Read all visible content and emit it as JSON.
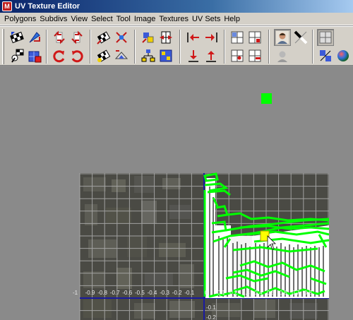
{
  "window": {
    "title": "UV Texture Editor",
    "app_icon": "maya-icon"
  },
  "menubar": {
    "items": [
      "Polygons",
      "Subdivs",
      "View",
      "Select",
      "Tool",
      "Image",
      "Textures",
      "UV Sets",
      "Help"
    ]
  },
  "toolbar": {
    "row1": [
      "checker-uv-icon",
      "flip-uv-icon",
      "rotate-left-arrows-icon",
      "rotate-right-arrows-icon",
      "checker-move-icon",
      "checker-scale-icon",
      "cut-uv-icon",
      "sew-uv-icon",
      "move-left-icon",
      "move-right-icon",
      "grid-snap-icon",
      "grid-add-icon",
      "user-portrait-icon",
      "black-white-icon",
      "display-grid-icon"
    ],
    "row2": [
      "paint-uv-icon",
      "select-shell-icon",
      "rotate-ccw-icon",
      "rotate-cw-icon",
      "checker-flip-icon",
      "checker-unfold-icon",
      "hierarchy-icon",
      "layout-uv-icon",
      "move-down-icon",
      "move-up-icon",
      "grid-point-icon",
      "grid-remove-icon",
      "user-portrait-gray-icon",
      "texture-swap-icon",
      "color-sphere-icon"
    ]
  },
  "viewport": {
    "axis_labels": [
      "-1",
      "-0.9",
      "-0.8",
      "-0.7",
      "-0.6",
      "-0.5",
      "-0.4",
      "-0.3",
      "-0.2",
      "-0.1",
      "0",
      "0.1",
      "0.2",
      "0.3",
      "0.4",
      "0.5",
      "0.6",
      "0.7",
      "0.8"
    ],
    "v_labels": [
      "-0.1",
      "-0.2"
    ],
    "uv_color": "#00ff00",
    "selected_color": "#ffff00",
    "grid_color": "#b0b0b0"
  }
}
